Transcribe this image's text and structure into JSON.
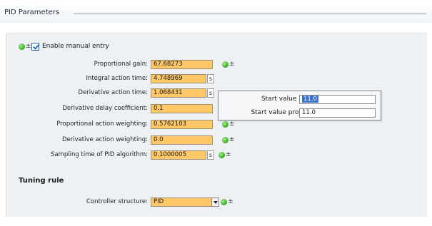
{
  "header": {
    "title": "PID Parameters"
  },
  "manual_entry": {
    "label": "Enable manual entry",
    "checked": true
  },
  "plus_minus_glyph": "±",
  "status_color": "#2eab1d",
  "field_color": "#ffc766",
  "params": [
    {
      "label": "Proportional gain:",
      "value": "67.68273",
      "unit": ""
    },
    {
      "label": "Integral action time:",
      "value": "4.748969",
      "unit": "s"
    },
    {
      "label": "Derivative action time:",
      "value": "1.068431",
      "unit": "s"
    },
    {
      "label": "Derivative delay coefficient:",
      "value": "0.1",
      "unit": ""
    },
    {
      "label": "Proportional action weighting:",
      "value": "0.5762103",
      "unit": ""
    },
    {
      "label": "Derivative action weighting:",
      "value": "0.0",
      "unit": ""
    },
    {
      "label": "Sampling time of PID algorithm:",
      "value": "0.1000005",
      "unit": "s"
    }
  ],
  "popup": {
    "plc_label": "Start value PLC:",
    "plc_value": "11.0",
    "project_label": "Start value project:",
    "project_value": "11.0"
  },
  "tuning": {
    "title": "Tuning rule",
    "controller_label": "Controller structure:",
    "controller_value": "PID"
  }
}
